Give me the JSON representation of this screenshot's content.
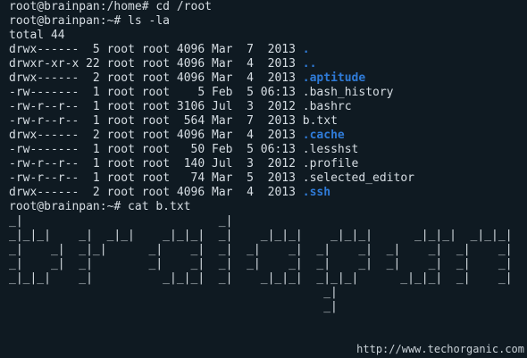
{
  "colors": {
    "background": "#0f1a22",
    "text": "#d6dde3",
    "directory": "#2f7bd8"
  },
  "terminal": {
    "prompt_1": "root@brainpan:/home# cd /root",
    "prompt_2": "root@brainpan:~# ls -la",
    "total": "total 44",
    "entries": [
      {
        "perm": "drwx------",
        "links": " 5",
        "owner": "root",
        "group": "root",
        "size": "4096",
        "date": "Mar  7  2013",
        "name": ".",
        "is_dir": true
      },
      {
        "perm": "drwxr-xr-x",
        "links": "22",
        "owner": "root",
        "group": "root",
        "size": "4096",
        "date": "Mar  4  2013",
        "name": "..",
        "is_dir": true
      },
      {
        "perm": "drwx------",
        "links": " 2",
        "owner": "root",
        "group": "root",
        "size": "4096",
        "date": "Mar  4  2013",
        "name": ".aptitude",
        "is_dir": true
      },
      {
        "perm": "-rw-------",
        "links": " 1",
        "owner": "root",
        "group": "root",
        "size": "   5",
        "date": "Feb  5 06:13",
        "name": ".bash_history",
        "is_dir": false
      },
      {
        "perm": "-rw-r--r--",
        "links": " 1",
        "owner": "root",
        "group": "root",
        "size": "3106",
        "date": "Jul  3  2012",
        "name": ".bashrc",
        "is_dir": false
      },
      {
        "perm": "-rw-r--r--",
        "links": " 1",
        "owner": "root",
        "group": "root",
        "size": " 564",
        "date": "Mar  7  2013",
        "name": "b.txt",
        "is_dir": false
      },
      {
        "perm": "drwx------",
        "links": " 2",
        "owner": "root",
        "group": "root",
        "size": "4096",
        "date": "Mar  4  2013",
        "name": ".cache",
        "is_dir": true
      },
      {
        "perm": "-rw-------",
        "links": " 1",
        "owner": "root",
        "group": "root",
        "size": "  50",
        "date": "Feb  5 06:13",
        "name": ".lesshst",
        "is_dir": false
      },
      {
        "perm": "-rw-r--r--",
        "links": " 1",
        "owner": "root",
        "group": "root",
        "size": " 140",
        "date": "Jul  3  2012",
        "name": ".profile",
        "is_dir": false
      },
      {
        "perm": "-rw-r--r--",
        "links": " 1",
        "owner": "root",
        "group": "root",
        "size": "  74",
        "date": "Mar  5  2013",
        "name": ".selected_editor",
        "is_dir": false
      },
      {
        "perm": "drwx------",
        "links": " 2",
        "owner": "root",
        "group": "root",
        "size": "4096",
        "date": "Mar  4  2013",
        "name": ".ssh",
        "is_dir": true
      }
    ],
    "prompt_3": "root@brainpan:~# cat b.txt",
    "ascii_art": [
      "_|                            _|",
      "_|_|_|    _|  _|_|    _|_|_|  _|    _|_|_|    _|_|_|      _|_|_|  _|_|_|",
      "_|    _|  _|_|      _|    _|  _|  _|    _|  _|    _|  _|    _|  _|    _|",
      "_|    _|  _|        _|    _|  _|  _|    _|  _|    _|  _|    _|  _|    _|",
      "_|_|_|    _|          _|_|_|  _|    _|_|_|  _|_|_|      _|_|_|  _|    _|",
      "                                             _|",
      "                                             _|"
    ]
  },
  "watermark": "http://www.techorganic.com"
}
